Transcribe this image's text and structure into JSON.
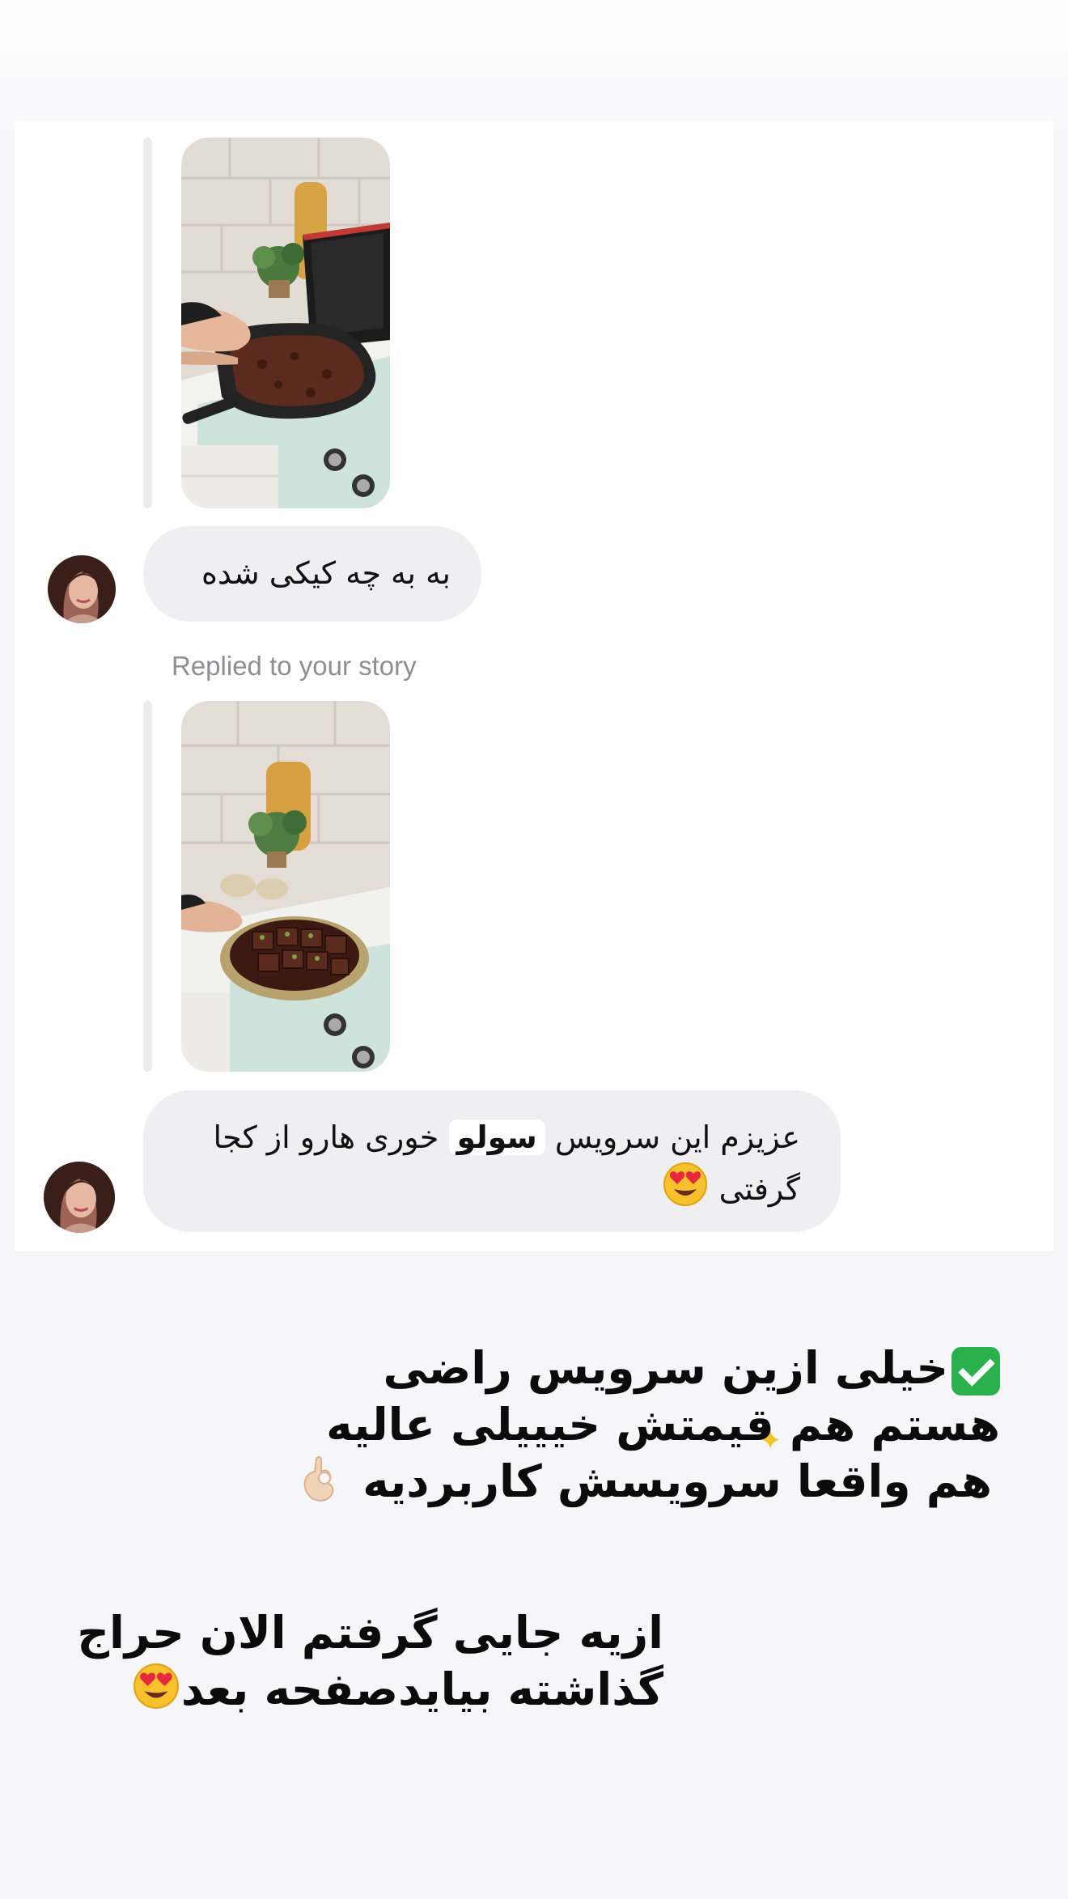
{
  "conversation": {
    "messages": [
      {
        "text": "به به چه کیکی شده"
      },
      {
        "replied_label": "Replied to your story",
        "text_before": "عزیزم این سرویس",
        "highlight": "سولو",
        "text_after": "خوری هارو از کجا گرفتی",
        "emoji": "heart-eyes-emoji"
      }
    ]
  },
  "story_overlay": {
    "line1": "خیلی ازین سرویس راضی",
    "line2": "هستم هم قیمتش خیییلی عالیه",
    "line3": "هم واقعا سرویسش کاربردیه",
    "line4": "ازیه جایی گرفتم الان حراج",
    "line5": "گذاشته بیایدصفحه بعد"
  },
  "icons": {
    "check": "check-box-icon",
    "ok_hand": "ok-hand-icon",
    "heart_eyes": "heart-eyes-emoji",
    "sparkle": "sparkle-icon"
  },
  "colors": {
    "bubble": "#efeff1",
    "check_green": "#2ab14d",
    "label_gray": "#8e8e93"
  }
}
